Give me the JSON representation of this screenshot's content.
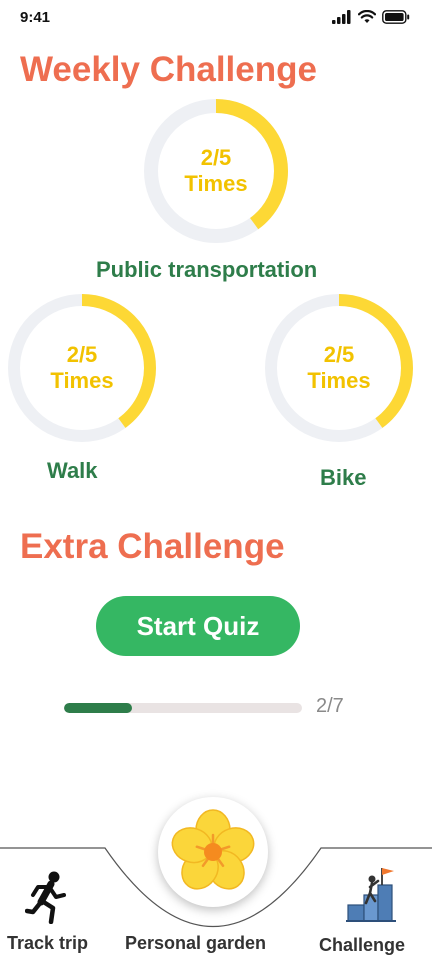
{
  "status_bar": {
    "time": "9:41"
  },
  "weekly": {
    "title": "Weekly Challenge",
    "rings": [
      {
        "id": "public-transportation",
        "count": "2/5",
        "unit": "Times",
        "label": "Public transportation",
        "progress": 0.4
      },
      {
        "id": "walk",
        "count": "2/5",
        "unit": "Times",
        "label": "Walk",
        "progress": 0.4
      },
      {
        "id": "bike",
        "count": "2/5",
        "unit": "Times",
        "label": "Bike",
        "progress": 0.4
      }
    ]
  },
  "extra": {
    "title": "Extra Challenge",
    "quiz_button": "Start Quiz",
    "progress_text": "2/7",
    "progress_value": 0.2857
  },
  "nav": {
    "track_trip": "Track trip",
    "personal_garden": "Personal garden",
    "challenge": "Challenge"
  },
  "colors": {
    "title": "#EE6E50",
    "ring_progress": "#FDD835",
    "ring_track": "#EEF0F4",
    "ring_text": "#F2C200",
    "label_green": "#2E7D4A",
    "quiz_green": "#35B763"
  }
}
